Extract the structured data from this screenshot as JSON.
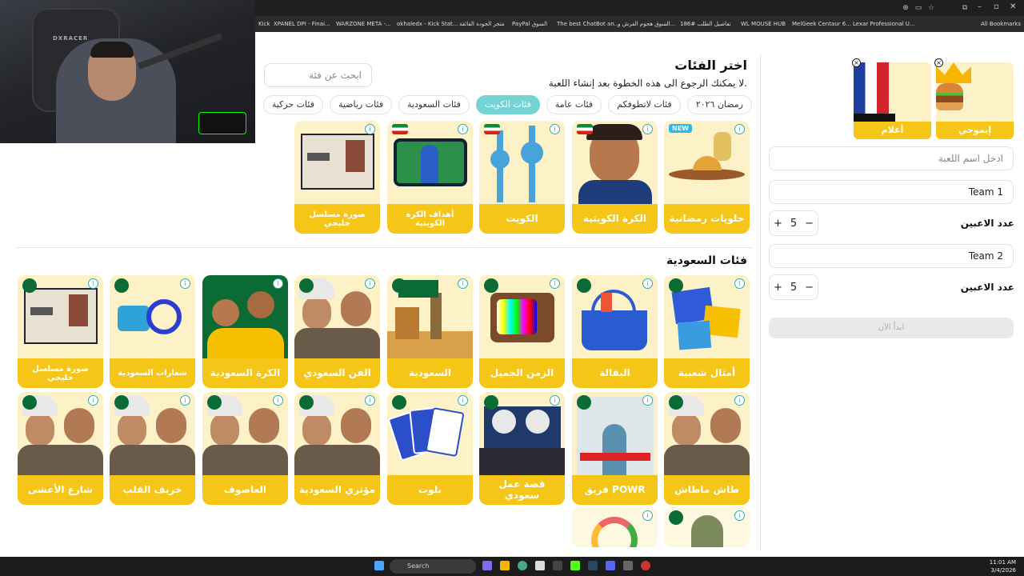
{
  "browser": {
    "bookmarks": [
      "Kick",
      "XPANEL DPI - Finai...",
      "WARZONE META -...",
      "okhaledx - Kick Stat...",
      "متجر الجودة الفائقة",
      "PayPal السوق",
      "The best ChatBot an...",
      "السوق هجوم الفرش و...",
      "تفاصيل الطلب #186",
      "WL MOUSE HUB",
      "MelGeek Centaur 6...",
      "Lexar Professional U...",
      "All Bookmarks"
    ]
  },
  "webcam": {
    "brand": "DXRACER"
  },
  "page": {
    "title": "اختر الفئات",
    "subtitle": "لا يمكنك الرجوع الى هذه الخطوة بعد إنشاء اللعبة.",
    "search_placeholder": "ابحث عن فئة",
    "chips": [
      {
        "label": "رمضان ٢٠٢٦",
        "active": false
      },
      {
        "label": "فئات لاتطوفكم",
        "active": false
      },
      {
        "label": "فئات عامة",
        "active": false
      },
      {
        "label": "فئات الكويت",
        "active": true
      },
      {
        "label": "فئات السعودية",
        "active": false
      },
      {
        "label": "فئات رياضية",
        "active": false
      },
      {
        "label": "فئات حركية",
        "active": false
      }
    ],
    "kuwait_row": [
      {
        "label": "حلويات رمضانية",
        "badge": "NEW",
        "art": "sweets"
      },
      {
        "label": "الكرة الكويتية",
        "art": "man"
      },
      {
        "label": "الكويت",
        "art": "towers"
      },
      {
        "label": "أهداف الكرة الكويتية",
        "art": "goals"
      },
      {
        "label": "صورة مسلسل خليجي",
        "art": "room"
      }
    ],
    "saudi_title": "فئات السعودية",
    "saudi_row1": [
      {
        "label": "أمثال شعبية",
        "art": "notes"
      },
      {
        "label": "البقالة",
        "art": "basket"
      },
      {
        "label": "الزمن الجميل",
        "art": "tv"
      },
      {
        "label": "السعودية",
        "art": "landmarks"
      },
      {
        "label": "الفن السعودي",
        "art": "people"
      },
      {
        "label": "الكرة السعودية",
        "art": "players"
      },
      {
        "label": "شعارات السعودية",
        "art": "logos"
      },
      {
        "label": "صورة مسلسل خليجي",
        "art": "room"
      }
    ],
    "saudi_row2": [
      {
        "label": "طاش ماطاش",
        "art": "people"
      },
      {
        "label": "فريق POWR",
        "art": "building"
      },
      {
        "label": "قصة عمل سعودي",
        "art": "group"
      },
      {
        "label": "بلوت",
        "art": "cards"
      },
      {
        "label": "مؤثري السعودية",
        "art": "people"
      },
      {
        "label": "العاصوف",
        "art": "people"
      },
      {
        "label": "خريف القلب",
        "art": "people"
      },
      {
        "label": "شارع الأعشى",
        "art": "people"
      }
    ],
    "info_icon": "i"
  },
  "right_panel": {
    "selected": [
      {
        "label": "إيموجي",
        "art": "emoji"
      },
      {
        "label": "أعلام",
        "art": "flags"
      }
    ],
    "game_name_placeholder": "ادخل اسم اللعبة",
    "team1": "Team 1",
    "team2": "Team 2",
    "players_label": "عدد الاعبين",
    "team1_players": "5",
    "team2_players": "5",
    "plus": "+",
    "minus": "−",
    "start_label": "ابدأ الآن"
  },
  "taskbar": {
    "search": "Search",
    "time": "11:01 AM",
    "date": "3/4/2026"
  }
}
